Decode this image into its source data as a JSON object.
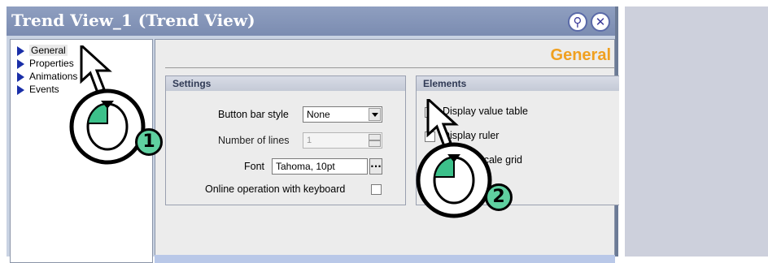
{
  "window": {
    "title": "Trend View_1 (Trend View)"
  },
  "titlebar_buttons": [
    {
      "icon": "pin-icon",
      "glyph": "⚲"
    },
    {
      "icon": "close-icon",
      "glyph": "✕"
    }
  ],
  "tree": {
    "items": [
      {
        "label": "General",
        "selected": true
      },
      {
        "label": "Properties"
      },
      {
        "label": "Animations"
      },
      {
        "label": "Events"
      }
    ]
  },
  "panel": {
    "title": "General",
    "settings": {
      "heading": "Settings",
      "button_bar_style_label": "Button bar style",
      "button_bar_style_value": "None",
      "number_of_lines_label": "Number of lines",
      "number_of_lines_value": "1",
      "font_label": "Font",
      "font_value": "Tahoma, 10pt",
      "font_button": "...",
      "online_operation_label": "Online operation with keyboard"
    },
    "elements": {
      "heading": "Elements",
      "display_value_table": "Display value table",
      "display_ruler": "Display ruler",
      "display_scale_grid": "Display scale grid"
    }
  },
  "annotations": {
    "step1": "1",
    "step2": "2"
  },
  "colors": {
    "accent_title": "#f0a020",
    "badge": "#5fd0a0",
    "titlebar": "#8494b8"
  }
}
